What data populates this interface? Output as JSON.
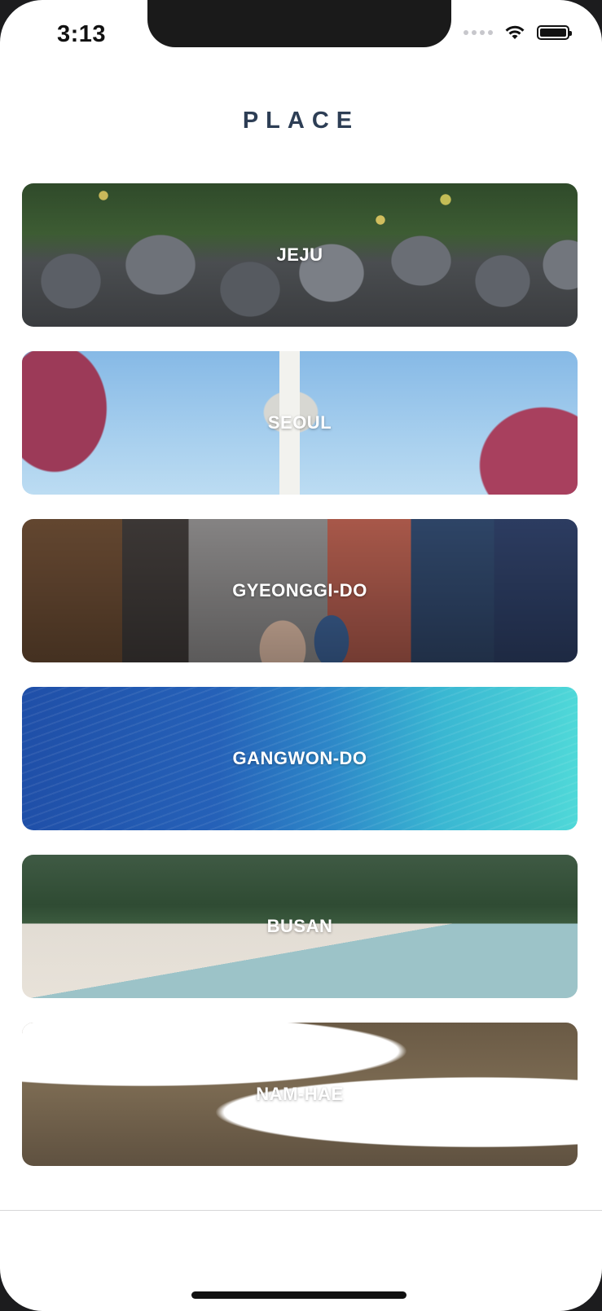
{
  "status_bar": {
    "time": "3:13",
    "icons": [
      "cellular-signal-icon",
      "wifi-icon",
      "battery-icon"
    ]
  },
  "header": {
    "title": "PLACE"
  },
  "places": [
    {
      "label": "JEJU",
      "image": "stone-wall-and-tangerine-trees"
    },
    {
      "label": "SEOUL",
      "image": "namsan-tower-with-red-trees"
    },
    {
      "label": "GYEONGGI-DO",
      "image": "crowded-market-street"
    },
    {
      "label": "GANGWON-DO",
      "image": "ocean-water-surface"
    },
    {
      "label": "BUSAN",
      "image": "beach-and-pine-forest"
    },
    {
      "label": "NAM-HAE",
      "image": "curved-ceiling-interior"
    }
  ],
  "colors": {
    "title": "#2d3e55",
    "label": "#ffffff",
    "background": "#ffffff"
  }
}
